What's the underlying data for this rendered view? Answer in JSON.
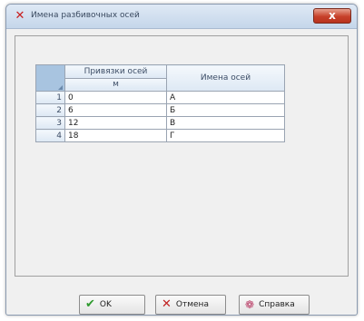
{
  "window": {
    "title": "Имена разбивочных осей",
    "close_glyph": "x"
  },
  "grid": {
    "headers": {
      "bindings": "Привязки осей",
      "bindings_unit": "м",
      "names": "Имена осей"
    },
    "rows": [
      {
        "num": "1",
        "binding": "0",
        "name": "А"
      },
      {
        "num": "2",
        "binding": "6",
        "name": "Б"
      },
      {
        "num": "3",
        "binding": "12",
        "name": "В"
      },
      {
        "num": "4",
        "binding": "18",
        "name": "Г"
      }
    ]
  },
  "buttons": {
    "ok": {
      "label": "OK",
      "icon": "checkmark-icon"
    },
    "cancel": {
      "label": "Отмена",
      "icon": "x-icon"
    },
    "help": {
      "label": "Справка",
      "icon": "help-icon"
    }
  },
  "colors": {
    "close_button": "#c7412a",
    "ok_check": "#2e9a2e",
    "cancel_x": "#c02020"
  }
}
